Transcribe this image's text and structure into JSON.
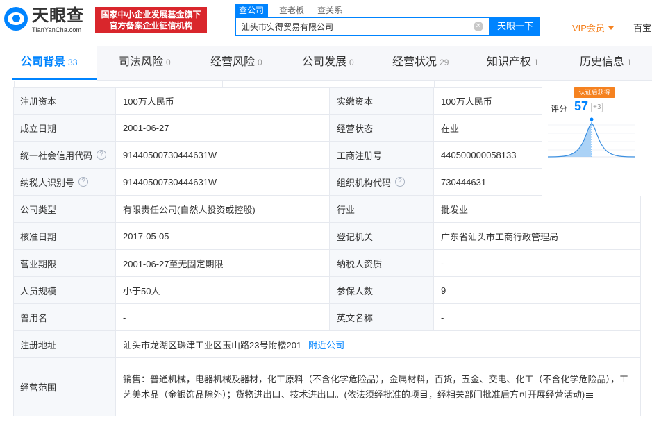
{
  "logo": {
    "name": "天眼查",
    "domain": "TianYanCha.com"
  },
  "badge": {
    "line1": "国家中小企业发展基金旗下",
    "line2": "官方备案企业征信机构"
  },
  "search": {
    "tabs": [
      "查公司",
      "查老板",
      "查关系"
    ],
    "value": "汕头市实得贸易有限公司",
    "button": "天眼一下"
  },
  "header": {
    "vip": "VIP会员",
    "baibao": "百宝"
  },
  "tabs": [
    {
      "label": "公司背景",
      "count": "33"
    },
    {
      "label": "司法风险",
      "count": "0"
    },
    {
      "label": "经营风险",
      "count": "0"
    },
    {
      "label": "公司发展",
      "count": "0"
    },
    {
      "label": "经营状况",
      "count": "29"
    },
    {
      "label": "知识产权",
      "count": "1"
    },
    {
      "label": "历史信息",
      "count": "1"
    }
  ],
  "info": {
    "reg_capital_label": "注册资本",
    "reg_capital": "100万人民币",
    "paid_capital_label": "实缴资本",
    "paid_capital": "100万人民币",
    "found_date_label": "成立日期",
    "found_date": "2001-06-27",
    "status_label": "经营状态",
    "status": "在业",
    "credit_code_label": "统一社会信用代码",
    "credit_code": "91440500730444631W",
    "reg_no_label": "工商注册号",
    "reg_no": "440500000058133",
    "taxpayer_id_label": "纳税人识别号",
    "taxpayer_id": "91440500730444631W",
    "org_code_label": "组织机构代码",
    "org_code": "730444631",
    "company_type_label": "公司类型",
    "company_type": "有限责任公司(自然人投资或控股)",
    "industry_label": "行业",
    "industry": "批发业",
    "approve_date_label": "核准日期",
    "approve_date": "2017-05-05",
    "authority_label": "登记机关",
    "authority": "广东省汕头市工商行政管理局",
    "term_label": "营业期限",
    "term": "2001-06-27至无固定期限",
    "tax_qual_label": "纳税人资质",
    "tax_qual": "-",
    "staff_label": "人员规模",
    "staff": "小于50人",
    "insured_label": "参保人数",
    "insured": "9",
    "former_name_label": "曾用名",
    "former_name": "-",
    "english_name_label": "英文名称",
    "english_name": "-",
    "address_label": "注册地址",
    "address": "汕头市龙湖区珠津工业区玉山路23号附楼201",
    "nearby": "附近公司",
    "scope_label": "经营范围",
    "scope": "销售：普通机械，电器机械及器材，化工原料（不含化学危险品），金属材料，百货，五金、交电、化工（不含化学危险品），工艺美术品（金银饰品除外）；货物进出口、技术进出口。(依法须经批准的项目，经相关部门批准后方可开展经营活动)"
  },
  "score": {
    "tag": "认证后获得",
    "label": "评分",
    "value": "57",
    "delta": "+3",
    "marker_fraction": 0.57
  },
  "colors": {
    "brand": "#0084ff",
    "badge": "#d9262c",
    "vip": "#f58220",
    "label_bg": "#f6f8fb"
  }
}
